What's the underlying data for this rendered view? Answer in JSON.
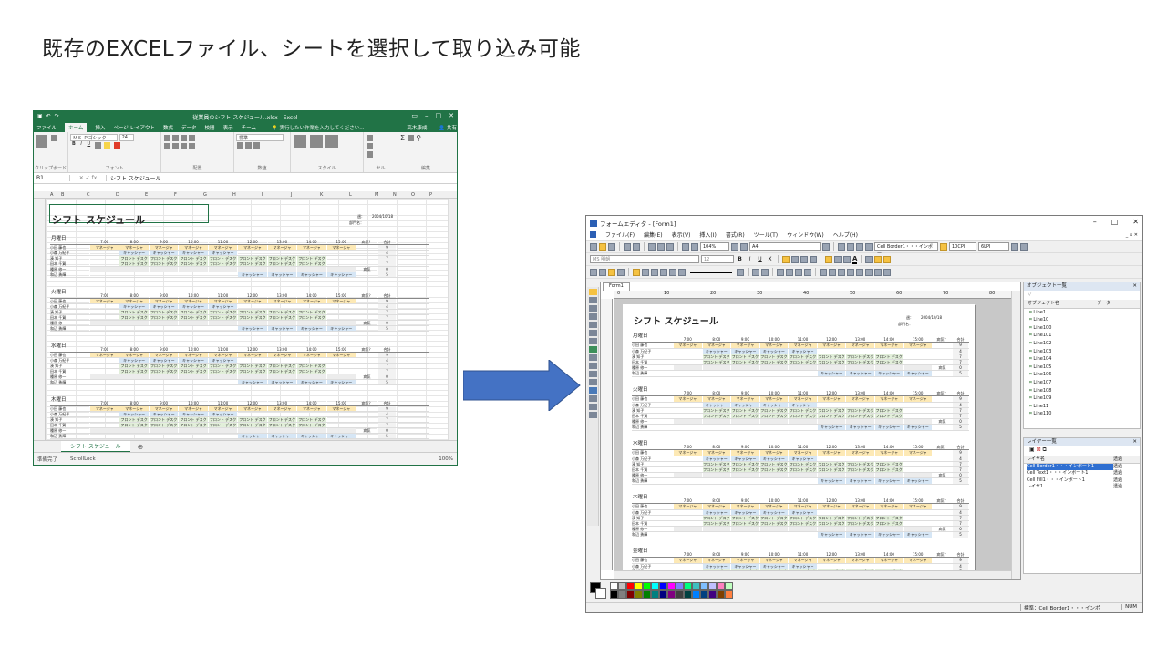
{
  "slide": {
    "title": "既存のEXCELファイル、シートを選択して取り込み可能"
  },
  "excel": {
    "window_title": "従業員のシフト スケジュール.xlsx - Excel",
    "tabs": [
      "ファイル",
      "ホーム",
      "挿入",
      "ページ レイアウト",
      "数式",
      "データ",
      "校閲",
      "表示",
      "チーム"
    ],
    "active_tab": "ホーム",
    "tell_me": "実行したい作業を入力してください...",
    "user": "高木康成",
    "share": "共有",
    "font_name": "ＭＳ Ｐゴシック",
    "font_size": "24",
    "number_format": "標準",
    "group_labels": [
      "クリップボード",
      "フォント",
      "配置",
      "数値",
      "スタイル",
      "セル",
      "編集"
    ],
    "name_box": "B1",
    "formula": "シフト スケジュール",
    "columns": [
      "A",
      "B",
      "C",
      "D",
      "E",
      "F",
      "G",
      "H",
      "I",
      "J",
      "K",
      "L",
      "M",
      "N",
      "O",
      "P"
    ],
    "sheet_tab": "シフト スケジュール",
    "status_left": "準備完了",
    "status_lock": "ScrollLock",
    "zoom": "100%"
  },
  "schedule": {
    "title": "シフト スケジュール",
    "week_label": "週：",
    "week_value": "2004/10/18",
    "dept_label": "部門名：",
    "times": [
      "7:00",
      "8:00",
      "9:00",
      "10:00",
      "11:00",
      "12:00",
      "13:00",
      "14:00",
      "15:00"
    ],
    "sick_label": "病気？",
    "total_label": "合計",
    "names": [
      "小田 藤也",
      "小森 万紀子",
      "湊 知子",
      "田本 千賀",
      "種原 修一",
      "和辺 勇輝"
    ],
    "totals": [
      "9",
      "4",
      "7",
      "7",
      "0",
      "5"
    ],
    "sick_mark": "病気",
    "manager": "マネージャ",
    "cashier": "キャッシャー",
    "front": "フロント デスク",
    "days": [
      "月曜日",
      "火曜日",
      "水曜日",
      "木曜日",
      "金曜日"
    ]
  },
  "form_editor": {
    "window_title": "フォームエディタ - [Form1]",
    "menu": [
      "ファイル(F)",
      "編集(E)",
      "表示(V)",
      "挿入(I)",
      "書式(R)",
      "ツール(T)",
      "ウィンドウ(W)",
      "ヘルプ(H)"
    ],
    "zoom": "104%",
    "paper": "A4",
    "font_name": "MS 明朝",
    "font_size": "12",
    "object_combo": "Cell Border1・・・インポー",
    "cpi": "10CPI",
    "lpi": "6LPI",
    "doc_tab": "Form1",
    "ruler_marks": [
      "0",
      "10",
      "20",
      "30",
      "40",
      "50",
      "60",
      "70",
      "80"
    ],
    "object_panel": {
      "title": "オブジェクト一覧",
      "col_name": "オブジェクト名",
      "col_data": "データ",
      "items": [
        "Line1",
        "Line10",
        "Line100",
        "Line101",
        "Line102",
        "Line103",
        "Line104",
        "Line105",
        "Line106",
        "Line107",
        "Line108",
        "Line109",
        "Line11",
        "Line110"
      ]
    },
    "layer_panel": {
      "title": "レイヤー一覧",
      "col_name": "レイヤ名",
      "col_state": "透過",
      "layers": [
        {
          "name": "Cell Border1・・・インポート1",
          "state": "透過",
          "selected": true
        },
        {
          "name": "Cell Text1・・・インポート1",
          "state": "透過",
          "selected": false
        },
        {
          "name": "Cell Fill1・・・インポート1",
          "state": "透過",
          "selected": false
        },
        {
          "name": "レイヤ1",
          "state": "透過",
          "selected": false
        }
      ]
    },
    "palette": [
      "#ffffff",
      "#c0c0c0",
      "#ff0000",
      "#ffff00",
      "#00ff00",
      "#00ffff",
      "#0000ff",
      "#ff00ff",
      "#7f7fff",
      "#00ff80",
      "#40c0c0",
      "#7fbfff",
      "#c0c0ff",
      "#ff80c0",
      "#c0ffc0",
      "#000000",
      "#808080",
      "#800000",
      "#808000",
      "#008000",
      "#008080",
      "#000080",
      "#800080",
      "#404040",
      "#004040",
      "#0080ff",
      "#004080",
      "#400080",
      "#804000",
      "#ff8040"
    ],
    "status_text": "標準：Cell Border1・・・インポ",
    "status_num": "NUM"
  },
  "colors": {
    "excel_green": "#217346",
    "arrow_blue": "#4472c4"
  }
}
